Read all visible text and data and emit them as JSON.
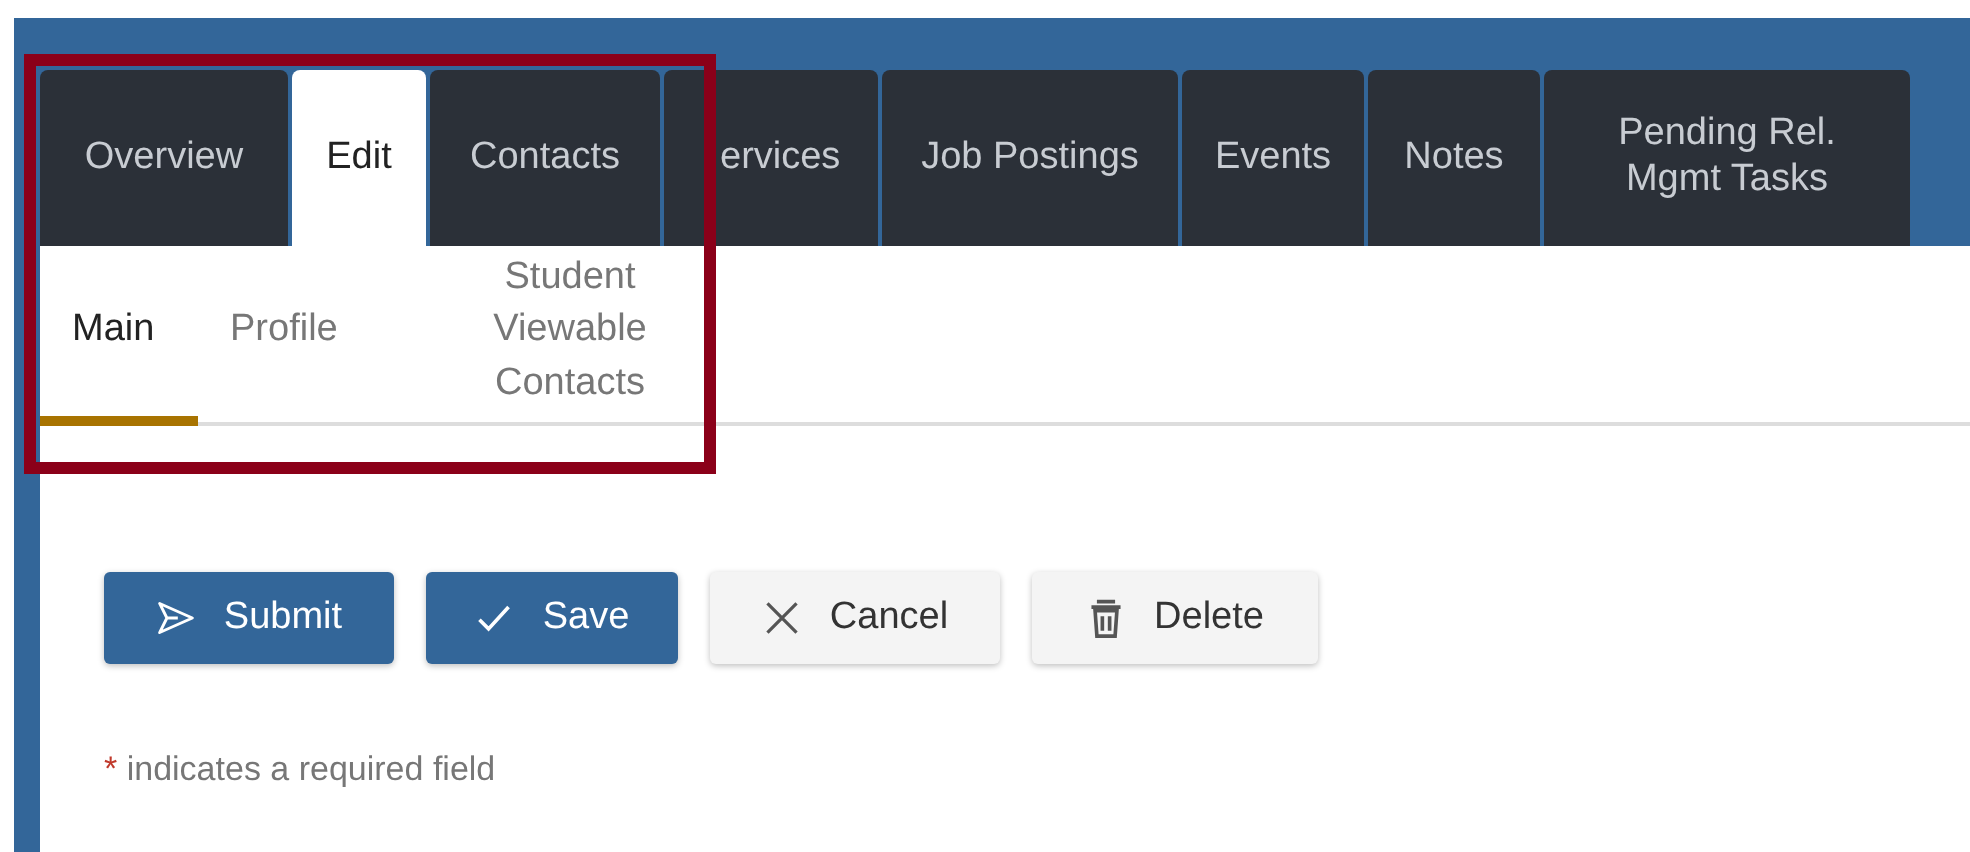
{
  "tabs": [
    {
      "label": "Overview",
      "selected": false
    },
    {
      "label": "Edit",
      "selected": true
    },
    {
      "label": "Contacts",
      "selected": false
    },
    {
      "label": "ervices",
      "selected": false
    },
    {
      "label": "Job Postings",
      "selected": false
    },
    {
      "label": "Events",
      "selected": false
    },
    {
      "label": "Notes",
      "selected": false
    },
    {
      "label": "Pending Rel. Mgmt Tasks",
      "selected": false
    }
  ],
  "subtabs": [
    {
      "label": "Main",
      "selected": true
    },
    {
      "label": "Profile",
      "selected": false
    },
    {
      "label": "Student Viewable Contacts",
      "selected": false
    }
  ],
  "buttons": [
    {
      "label": "Submit",
      "kind": "submit"
    },
    {
      "label": "Save",
      "kind": "save"
    },
    {
      "label": "Cancel",
      "kind": "cancel"
    },
    {
      "label": "Delete",
      "kind": "delete"
    }
  ],
  "required_note": {
    "mark": "*",
    "text": "indicates a required field"
  }
}
